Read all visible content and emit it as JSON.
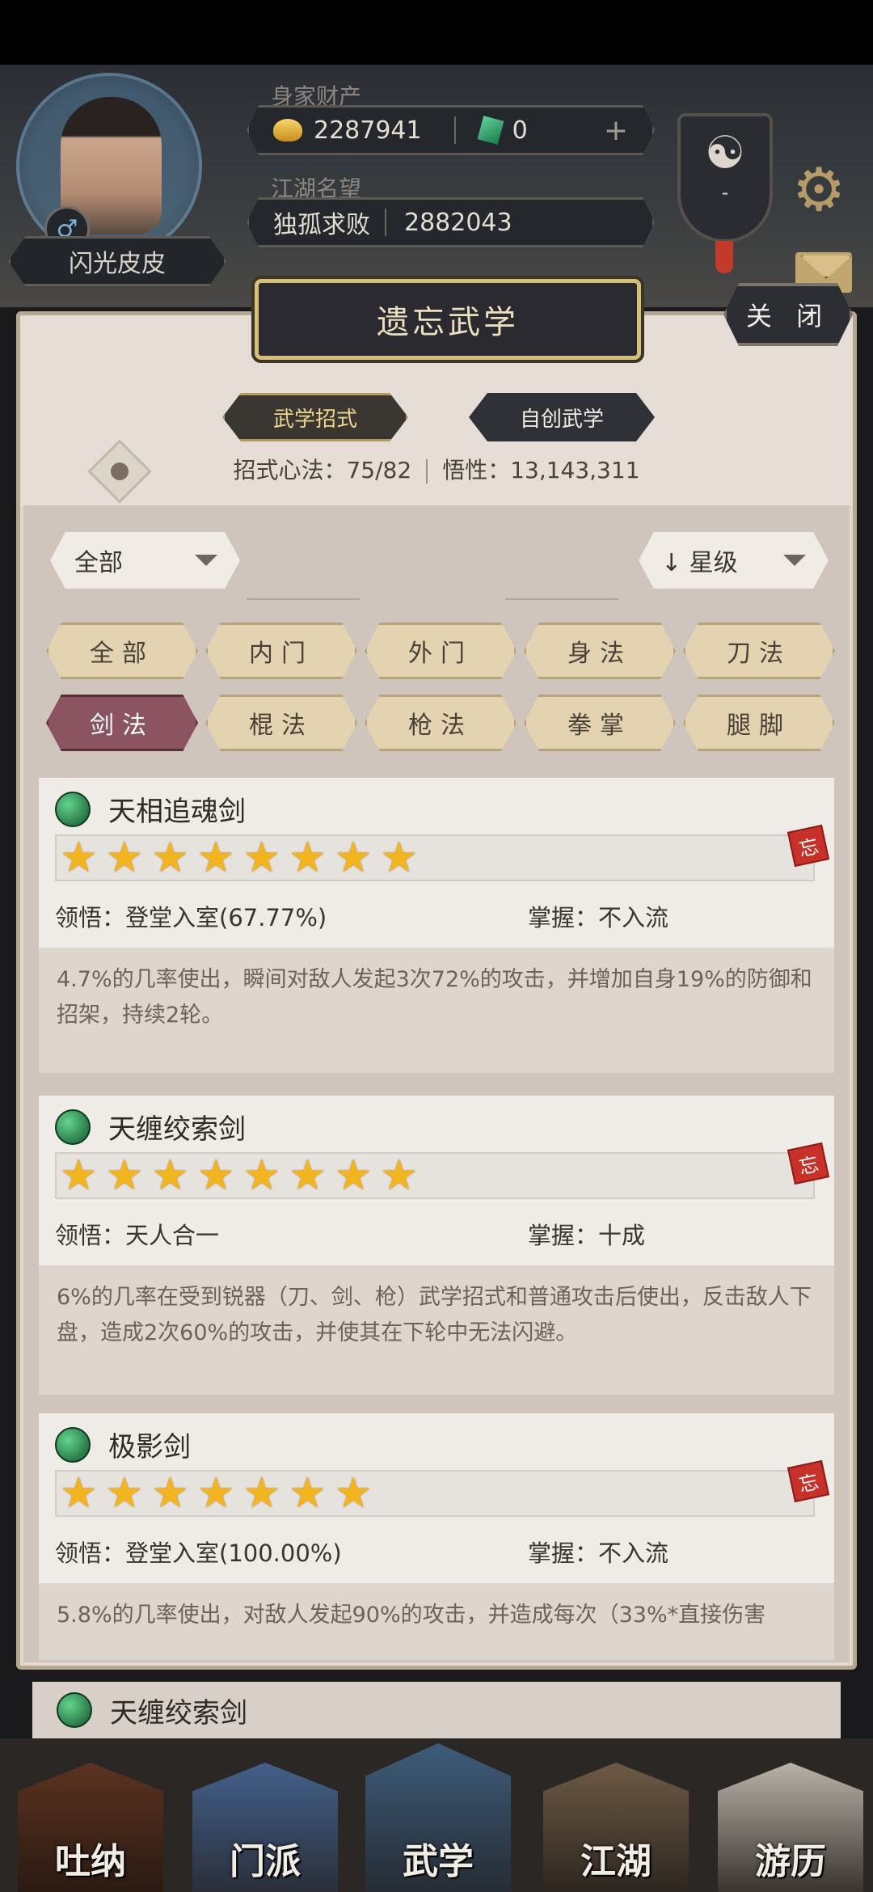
{
  "header": {
    "player_name": "闪光皮皮",
    "gender_symbol": "♂",
    "wealth_label": "身家财产",
    "gold_amount": "2287941",
    "jade_amount": "0",
    "plus_symbol": "+",
    "reputation_label": "江湖名望",
    "reputation_title": "独孤求败",
    "reputation_value": "2882043",
    "taiji_symbol": "☯",
    "taiji_dash": "-",
    "gear_symbol": "⚙"
  },
  "panel": {
    "title": "遗忘武学",
    "close_label": "关 闭",
    "tab_moves": "武学招式",
    "tab_custom": "自创武学",
    "stats_moves": "招式心法：75/82",
    "stats_insight": "悟性：13,143,311",
    "filter_all": "全部",
    "sort_label": "↓ 星级",
    "categories": [
      "全部",
      "内门",
      "外门",
      "身法",
      "刀法",
      "剑法",
      "棍法",
      "枪法",
      "拳掌",
      "腿脚"
    ],
    "active_category": "剑法"
  },
  "skills": [
    {
      "name": "天相追魂剑",
      "stars": 8,
      "tag": "忘",
      "comprehension": "领悟：登堂入室(67.77%)",
      "mastery": "掌握：不入流",
      "description": "4.7%的几率使出，瞬间对敌人发起3次72%的攻击，并增加自身19%的防御和招架，持续2轮。"
    },
    {
      "name": "天缠绞索剑",
      "stars": 8,
      "tag": "忘",
      "comprehension": "领悟：天人合一",
      "mastery": "掌握：十成",
      "description": "6%的几率在受到锐器（刀、剑、枪）武学招式和普通攻击后使出，反击敌人下盘，造成2次60%的攻击，并使其在下轮中无法闪避。"
    },
    {
      "name": "极影剑",
      "stars": 7,
      "tag": "忘",
      "comprehension": "领悟：登堂入室(100.00%)",
      "mastery": "掌握：不入流",
      "description": "5.8%的几率使出，对敌人发起90%的攻击，并造成每次（33%*直接伤害"
    }
  ],
  "behind_card_name": "天缠绞索剑",
  "bottom_nav": [
    "吐纳",
    "门派",
    "武学",
    "江湖",
    "游历"
  ]
}
